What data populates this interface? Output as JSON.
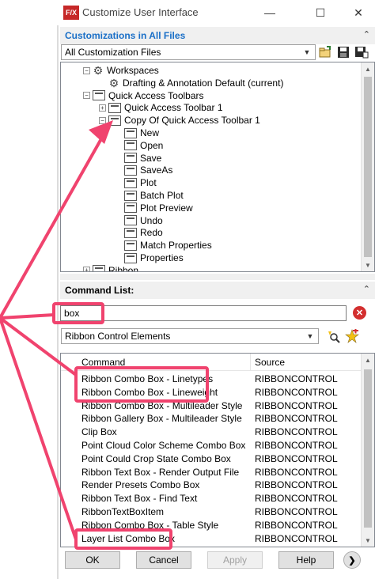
{
  "window": {
    "logo_text": "F/X",
    "title": "Customize User Interface",
    "minimize_glyph": "—",
    "maximize_glyph": "☐",
    "close_glyph": "✕"
  },
  "customizations": {
    "header": "Customizations in All Files",
    "collapse_glyph": "⌃",
    "file_dropdown": "All Customization Files",
    "tree": [
      {
        "label": "Workspaces",
        "icon": "gear-icon",
        "expander": "−"
      },
      {
        "label": "Drafting & Annotation Default (current)",
        "icon": "gear-icon"
      },
      {
        "label": "Quick Access Toolbars",
        "icon": "toolbar-icon",
        "expander": "−"
      },
      {
        "label": "Quick Access Toolbar 1",
        "icon": "toolbar-icon",
        "expander": "+"
      },
      {
        "label": "Copy Of Quick Access Toolbar 1",
        "icon": "toolbar-icon",
        "expander": "−"
      },
      {
        "label": "New",
        "icon": "command-icon"
      },
      {
        "label": "Open",
        "icon": "command-icon"
      },
      {
        "label": "Save",
        "icon": "command-icon"
      },
      {
        "label": "SaveAs",
        "icon": "command-icon"
      },
      {
        "label": "Plot",
        "icon": "command-icon"
      },
      {
        "label": "Batch Plot",
        "icon": "command-icon"
      },
      {
        "label": "Plot Preview",
        "icon": "command-icon"
      },
      {
        "label": "Undo",
        "icon": "command-icon"
      },
      {
        "label": "Redo",
        "icon": "command-icon"
      },
      {
        "label": "Match Properties",
        "icon": "command-icon"
      },
      {
        "label": "Properties",
        "icon": "command-icon"
      },
      {
        "label": "Ribbon",
        "icon": "toolbar-icon",
        "expander": "+"
      }
    ]
  },
  "command_list": {
    "header": "Command List:",
    "collapse_glyph": "⌃",
    "search_value": "box",
    "clear_glyph": "✕",
    "filter_dropdown": "Ribbon Control Elements",
    "columns": [
      "Command",
      "Source"
    ],
    "rows": [
      {
        "command": "Ribbon Combo Box - Linetypes",
        "source": "RIBBONCONTROL"
      },
      {
        "command": "Ribbon Combo Box - Lineweight",
        "source": "RIBBONCONTROL"
      },
      {
        "command": "Ribbon Combo Box - Multileader Style",
        "source": "RIBBONCONTROL"
      },
      {
        "command": "Ribbon Gallery Box - Multileader Style",
        "source": "RIBBONCONTROL"
      },
      {
        "command": "Clip Box",
        "source": "RIBBONCONTROL"
      },
      {
        "command": "Point Cloud Color Scheme Combo Box",
        "source": "RIBBONCONTROL"
      },
      {
        "command": "Point Could Crop State Combo Box",
        "source": "RIBBONCONTROL"
      },
      {
        "command": "Ribbon Text Box - Render Output File",
        "source": "RIBBONCONTROL"
      },
      {
        "command": "Render Presets Combo Box",
        "source": "RIBBONCONTROL"
      },
      {
        "command": "Ribbon Text Box - Find Text",
        "source": "RIBBONCONTROL"
      },
      {
        "command": "RibbonTextBoxItem",
        "source": "RIBBONCONTROL"
      },
      {
        "command": "Ribbon Combo Box - Table Style",
        "source": "RIBBONCONTROL"
      },
      {
        "command": "Layer List Combo Box",
        "source": "RIBBONCONTROL"
      }
    ]
  },
  "buttons": {
    "ok": "OK",
    "cancel": "Cancel",
    "apply": "Apply",
    "help": "Help",
    "more_glyph": "❯"
  },
  "colors": {
    "header_blue": "#1a6fc7",
    "highlight_pink": "#f0436e"
  }
}
